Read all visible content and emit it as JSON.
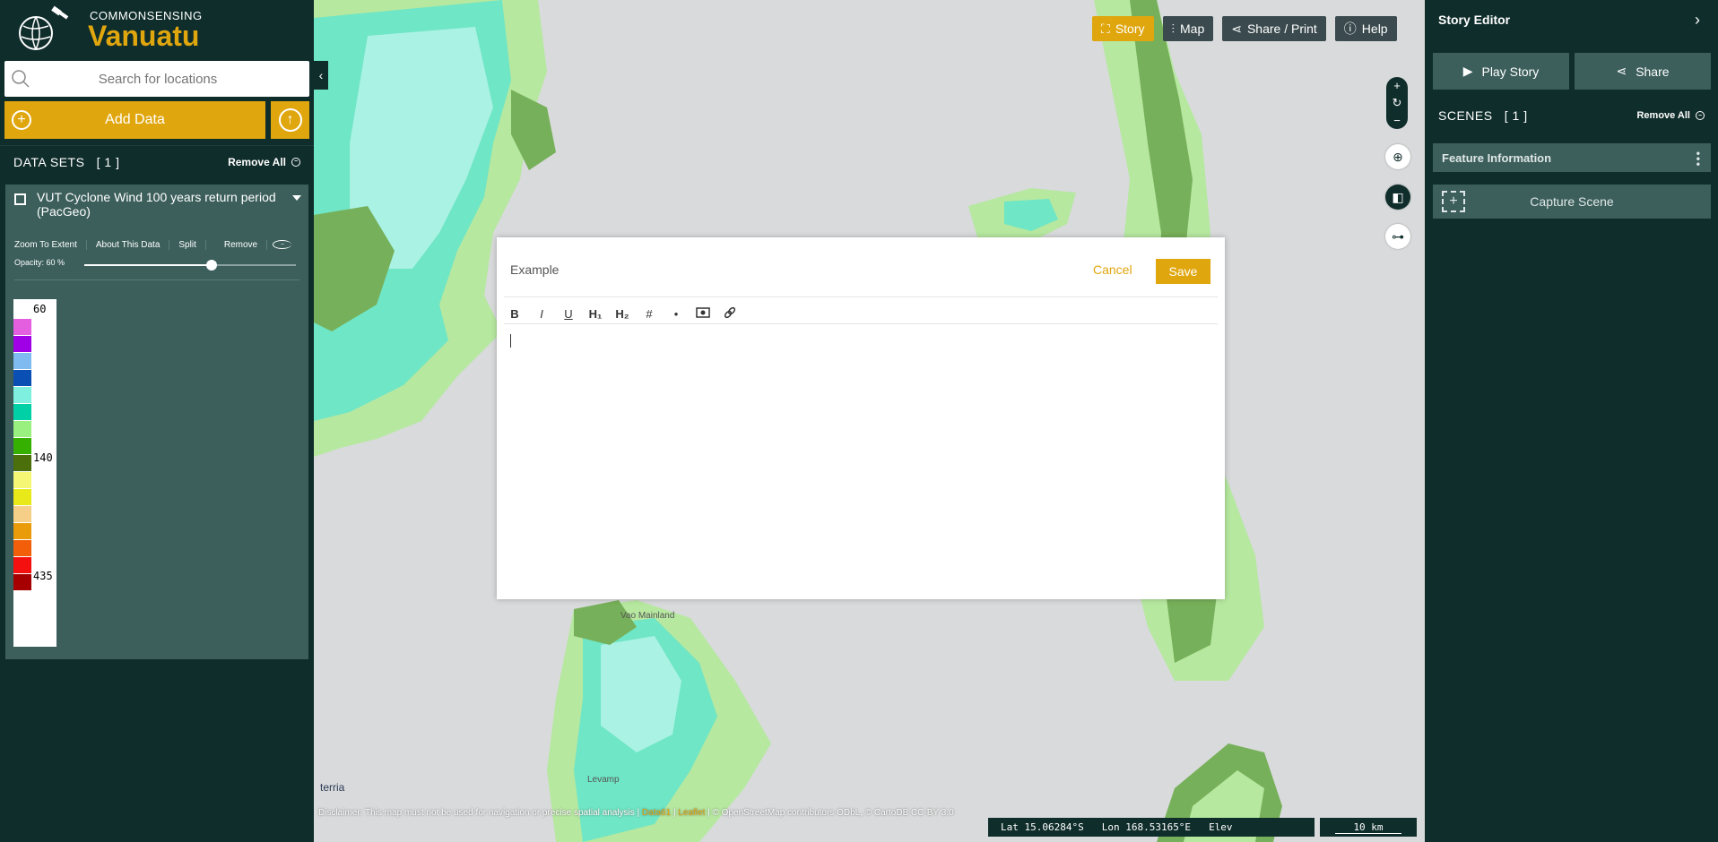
{
  "brand": {
    "top": "COMMONSENSING",
    "name": "Vanuatu"
  },
  "search": {
    "placeholder": "Search for locations"
  },
  "buttons": {
    "add_data": "Add Data"
  },
  "datasets": {
    "header": "DATA SETS",
    "count": "[ 1 ]",
    "remove_all": "Remove All",
    "item": {
      "title": "VUT Cyclone Wind 100 years return period (PacGeo)",
      "actions": [
        "Zoom To Extent",
        "About This Data",
        "Split",
        "Remove"
      ],
      "opacity_label": "Opacity: 60 %",
      "opacity": 0.6
    }
  },
  "legend": {
    "labels": [
      {
        "text": "60"
      },
      {
        "text": "140"
      },
      {
        "text": "435"
      }
    ],
    "colors": [
      "#e45ee0",
      "#a000e6",
      "#7fbbf0",
      "#0a4fb4",
      "#7ff0e0",
      "#00d0a6",
      "#9af07e",
      "#36b000",
      "#4b6f0a",
      "#f6f675",
      "#e9e91a",
      "#f5cf87",
      "#e99b0a",
      "#f25e0a",
      "#f51010",
      "#a70000"
    ]
  },
  "topbar": {
    "story": "Story",
    "map": "Map",
    "share_print": "Share / Print",
    "help": "Help"
  },
  "editor": {
    "title": "Example",
    "cancel": "Cancel",
    "save": "Save",
    "toolbar": [
      "B",
      "I",
      "U",
      "H₁",
      "H₂",
      "#",
      "•"
    ]
  },
  "footer": {
    "disclaimer": "Disclaimer: This map must not be used for navigation or precise spatial analysis |",
    "link1": "Data61",
    "sep": "|",
    "link2": "Leaflet",
    "attribution": "| © OpenStreetMap contributors ODbL, © CartoDB CC-BY 3.0",
    "lat": "Lat  15.06284°S",
    "lon": "Lon  168.53165°E",
    "elev": "Elev",
    "scale": "10 km",
    "terria": "terria"
  },
  "places": {
    "p1": "Vao Mainland",
    "p2": "Levamp"
  },
  "story_editor": {
    "title": "Story Editor",
    "play": "Play Story",
    "share": "Share",
    "scenes": "SCENES",
    "scenes_count": "[ 1 ]",
    "remove_all": "Remove All",
    "scene_title": "Feature Information",
    "capture": "Capture Scene"
  },
  "colors": {
    "accent": "#e0a60e",
    "panel": "#0f2d2b",
    "card": "#3c5f5c"
  }
}
